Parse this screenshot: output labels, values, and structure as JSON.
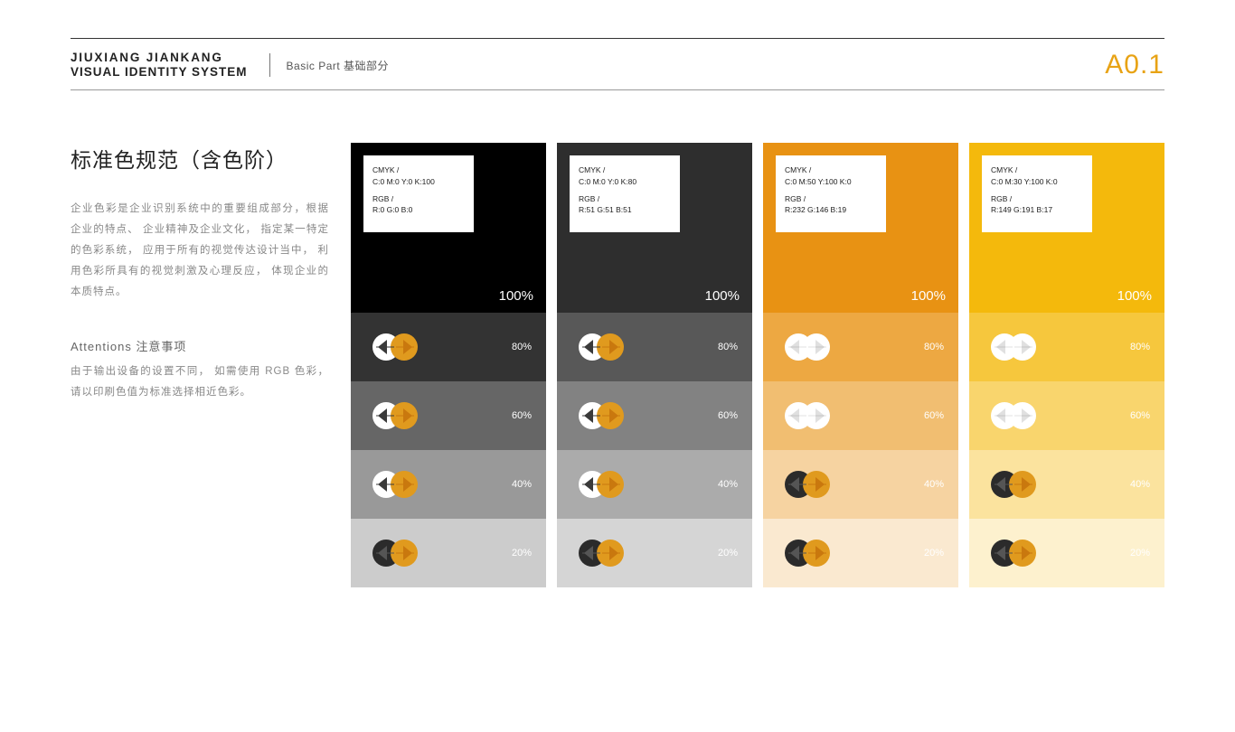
{
  "header": {
    "brand_line1": "JIUXIANG JIANKANG",
    "brand_line2": "VISUAL IDENTITY SYSTEM",
    "subtitle": "Basic Part 基础部分",
    "page_code": "A0.1"
  },
  "side": {
    "title": "标准色规范（含色阶）",
    "paragraph": "企业色彩是企业识别系统中的重要组成部分，根据企业的特点、 企业精神及企业文化， 指定某一特定的色彩系统， 应用于所有的视觉传达设计当中， 利用色彩所具有的视觉刺激及心理反应， 体现企业的本质特点。",
    "attn_title": "Attentions 注意事项",
    "attn_para": "由于输出设备的设置不同， 如需使用 RGB 色彩， 请以印刷色值为标准选择相近色彩。"
  },
  "labels": {
    "cmyk": "CMYK /",
    "rgb": "RGB /",
    "p100": "100%",
    "p80": "80%",
    "p60": "60%",
    "p40": "40%",
    "p20": "20%"
  },
  "columns": [
    {
      "cmyk_val": "C:0 M:0 Y:0 K:100",
      "rgb_val": "R:0 G:0 B:0",
      "base": "#000000",
      "tints": [
        "#333333",
        "#666666",
        "#999999",
        "#CCCCCC"
      ],
      "logo_variant": [
        "A",
        "A",
        "A",
        "B"
      ]
    },
    {
      "cmyk_val": "C:0 M:0 Y:0 K:80",
      "rgb_val": "R:51 G:51 B:51",
      "base": "#2E2E2E",
      "tints": [
        "#585858",
        "#828282",
        "#ABABAB",
        "#D5D5D5"
      ],
      "logo_variant": [
        "A",
        "A",
        "A",
        "B"
      ]
    },
    {
      "cmyk_val": "C:0 M:50 Y:100 K:0",
      "rgb_val": "R:232 G:146 B:19",
      "base": "#E89213",
      "tints": [
        "#EDA842",
        "#F1BE71",
        "#F6D3A1",
        "#FAE9D0"
      ],
      "logo_variant": [
        "C",
        "C",
        "B",
        "B"
      ]
    },
    {
      "cmyk_val": "C:0 M:30 Y:100 K:0",
      "rgb_val": "R:149 G:191 B:17",
      "base": "#F4B90C",
      "tints": [
        "#F6C73D",
        "#F9D56D",
        "#FBE39E",
        "#FDF1CE"
      ],
      "logo_variant": [
        "C",
        "C",
        "B",
        "B"
      ]
    }
  ]
}
